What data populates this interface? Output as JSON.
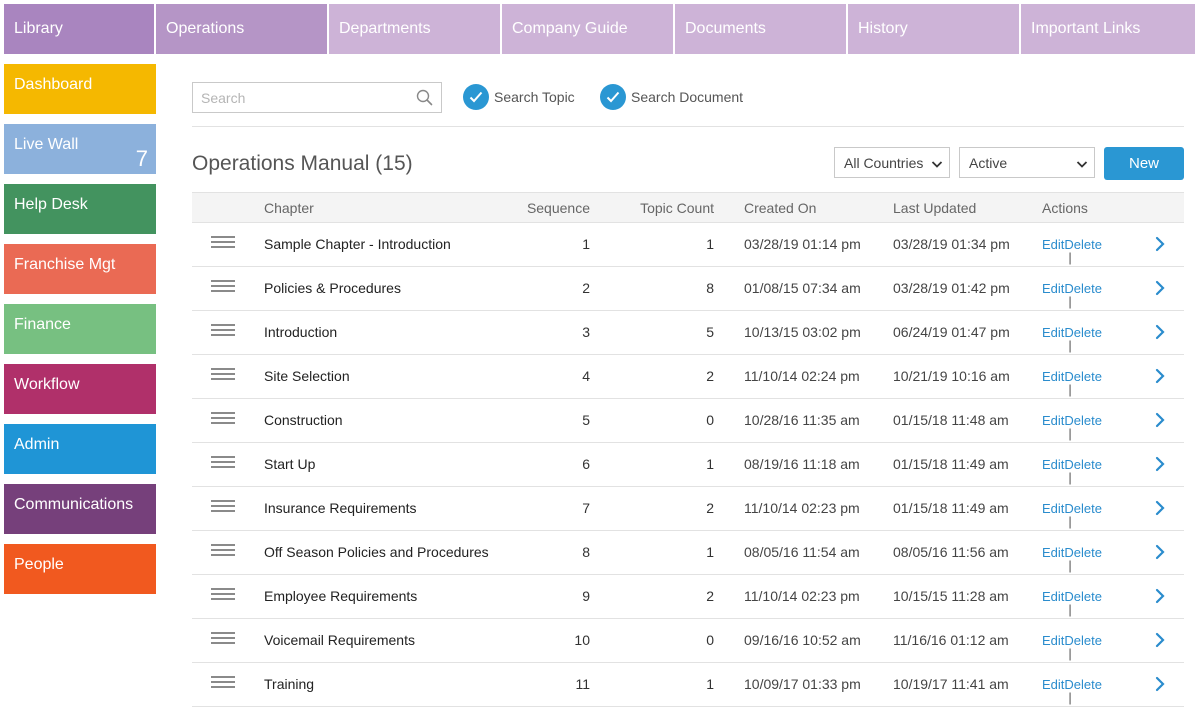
{
  "top_nav": [
    {
      "label": "Library"
    },
    {
      "label": "Operations"
    },
    {
      "label": "Departments"
    },
    {
      "label": "Company Guide"
    },
    {
      "label": "Documents"
    },
    {
      "label": "History"
    },
    {
      "label": "Important Links"
    }
  ],
  "sidebar": [
    {
      "label": "Dashboard",
      "color": "#f5b800"
    },
    {
      "label": "Live Wall",
      "color": "#8cb1dc",
      "count": "7"
    },
    {
      "label": "Help Desk",
      "color": "#43935f"
    },
    {
      "label": "Franchise Mgt",
      "color": "#ea6a54"
    },
    {
      "label": "Finance",
      "color": "#77c081"
    },
    {
      "label": "Workflow",
      "color": "#b0306a"
    },
    {
      "label": "Admin",
      "color": "#1f95d6"
    },
    {
      "label": "Communications",
      "color": "#76407b"
    },
    {
      "label": "People",
      "color": "#f1591f"
    }
  ],
  "search": {
    "placeholder": "Search",
    "options": [
      {
        "label": "Search Topic",
        "checked": true
      },
      {
        "label": "Search Document",
        "checked": true
      }
    ]
  },
  "page": {
    "title": "Operations Manual (15)",
    "country_filter": "All Countries",
    "status_filter": "Active",
    "new_button": "New"
  },
  "table": {
    "headers": {
      "chapter": "Chapter",
      "sequence": "Sequence",
      "topic_count": "Topic Count",
      "created_on": "Created On",
      "last_updated": "Last Updated",
      "actions": "Actions"
    },
    "edit_label": "Edit",
    "delete_label": "Delete",
    "rows": [
      {
        "chapter": "Sample Chapter - Introduction",
        "sequence": "1",
        "topic_count": "1",
        "created_on": "03/28/19 01:14 pm",
        "last_updated": "03/28/19 01:34 pm"
      },
      {
        "chapter": "Policies & Procedures",
        "sequence": "2",
        "topic_count": "8",
        "created_on": "01/08/15 07:34 am",
        "last_updated": "03/28/19 01:42 pm"
      },
      {
        "chapter": "Introduction",
        "sequence": "3",
        "topic_count": "5",
        "created_on": "10/13/15 03:02 pm",
        "last_updated": "06/24/19 01:47 pm"
      },
      {
        "chapter": "Site Selection",
        "sequence": "4",
        "topic_count": "2",
        "created_on": "11/10/14 02:24 pm",
        "last_updated": "10/21/19 10:16 am"
      },
      {
        "chapter": "Construction",
        "sequence": "5",
        "topic_count": "0",
        "created_on": "10/28/16 11:35 am",
        "last_updated": "01/15/18 11:48 am"
      },
      {
        "chapter": "Start Up",
        "sequence": "6",
        "topic_count": "1",
        "created_on": "08/19/16 11:18 am",
        "last_updated": "01/15/18 11:49 am"
      },
      {
        "chapter": "Insurance Requirements",
        "sequence": "7",
        "topic_count": "2",
        "created_on": "11/10/14 02:23 pm",
        "last_updated": "01/15/18 11:49 am"
      },
      {
        "chapter": "Off Season Policies and Procedures",
        "sequence": "8",
        "topic_count": "1",
        "created_on": "08/05/16 11:54 am",
        "last_updated": "08/05/16 11:56 am"
      },
      {
        "chapter": "Employee Requirements",
        "sequence": "9",
        "topic_count": "2",
        "created_on": "11/10/14 02:23 pm",
        "last_updated": "10/15/15 11:28 am"
      },
      {
        "chapter": "Voicemail Requirements",
        "sequence": "10",
        "topic_count": "0",
        "created_on": "09/16/16 10:52 am",
        "last_updated": "11/16/16 01:12 am"
      },
      {
        "chapter": "Training",
        "sequence": "11",
        "topic_count": "1",
        "created_on": "10/09/17 01:33 pm",
        "last_updated": "10/19/17 11:41 am"
      }
    ]
  },
  "colors": {
    "accent": "#2a97d3",
    "nav_active": "#b595c6",
    "nav_inactive": "#cdb3d7",
    "nav_library": "#a985bf"
  }
}
